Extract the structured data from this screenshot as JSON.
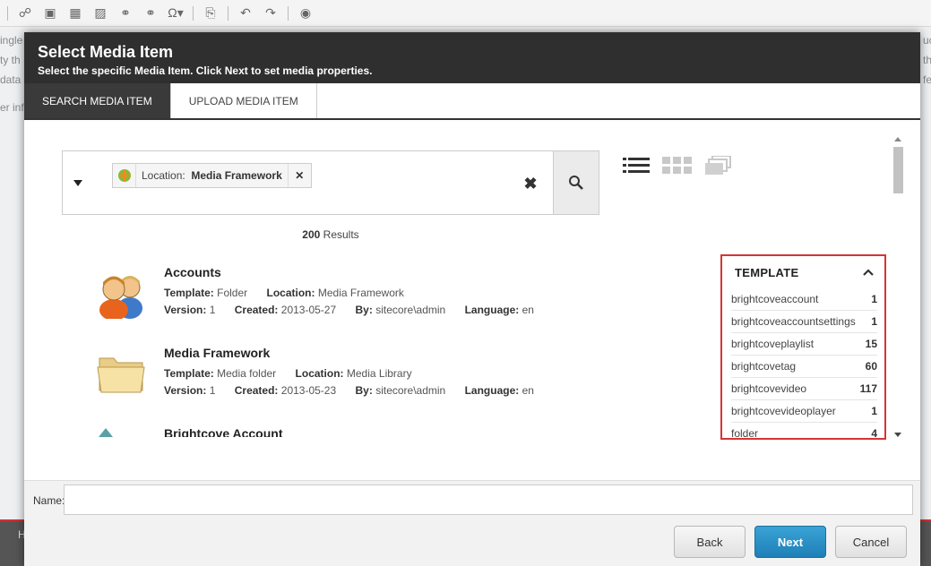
{
  "dialog": {
    "title": "Select Media Item",
    "subtitle": "Select the specific Media Item. Click Next to set media properties."
  },
  "tabs": [
    {
      "label": "SEARCH MEDIA ITEM",
      "active": true
    },
    {
      "label": "UPLOAD MEDIA ITEM",
      "active": false
    }
  ],
  "search": {
    "facet_chip": {
      "label": "Location:",
      "value": "Media Framework"
    },
    "results_count": "200",
    "results_label": " Results"
  },
  "results": [
    {
      "name": "Accounts",
      "template_label": "Template:",
      "template": "Folder",
      "location_label": "Location:",
      "location": "Media Framework",
      "version_label": "Version:",
      "version": "1",
      "created_label": "Created:",
      "created": "2013-05-27",
      "by_label": "By:",
      "by": "sitecore\\admin",
      "language_label": "Language:",
      "language": "en",
      "icon": "users-icon"
    },
    {
      "name": "Media Framework",
      "template_label": "Template:",
      "template": "Media folder",
      "location_label": "Location:",
      "location": "Media Library",
      "version_label": "Version:",
      "version": "1",
      "created_label": "Created:",
      "created": "2013-05-23",
      "by_label": "By:",
      "by": "sitecore\\admin",
      "language_label": "Language:",
      "language": "en",
      "icon": "folder-icon"
    },
    {
      "name": "Brightcove Account",
      "icon": "account-icon"
    }
  ],
  "facet": {
    "title": "TEMPLATE",
    "items": [
      {
        "label": "brightcoveaccount",
        "count": "1"
      },
      {
        "label": "brightcoveaccountsettings",
        "count": "1"
      },
      {
        "label": "brightcoveplaylist",
        "count": "15"
      },
      {
        "label": "brightcovetag",
        "count": "60"
      },
      {
        "label": "brightcovevideo",
        "count": "117"
      },
      {
        "label": "brightcovevideoplayer",
        "count": "1"
      },
      {
        "label": "folder",
        "count": "4"
      }
    ]
  },
  "name_field": {
    "label": "Name:",
    "value": ""
  },
  "buttons": {
    "back": "Back",
    "next": "Next",
    "cancel": "Cancel"
  },
  "background": {
    "left_fragments": [
      "ingle",
      "ty th",
      "data",
      "er inf"
    ],
    "right_fragments": [
      "uct",
      "th",
      "fe"
    ],
    "bottom_fragment": "H"
  },
  "colors": {
    "accent": "#1e7fb6",
    "header": "#2f2f2f",
    "highlight_border": "#d63434"
  }
}
